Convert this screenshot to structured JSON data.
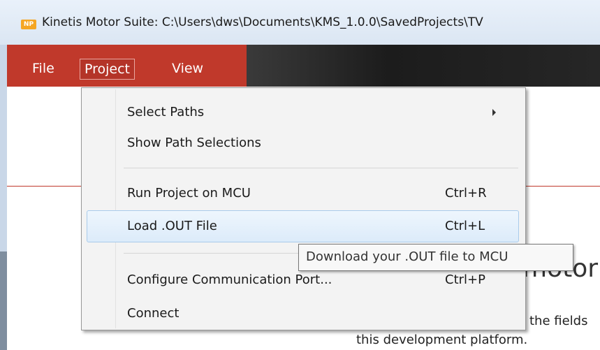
{
  "window": {
    "logo_text": "NP",
    "title": "Kinetis Motor Suite: C:\\Users\\dws\\Documents\\KMS_1.0.0\\SavedProjects\\TV"
  },
  "menubar": {
    "file": "File",
    "project": "Project",
    "view": "View"
  },
  "project_menu": {
    "items": [
      {
        "label": "Select Paths",
        "shortcut": "",
        "submenu": true
      },
      {
        "label": "Show Path Selections",
        "shortcut": ""
      },
      {
        "label": "Run Project on MCU",
        "shortcut": "Ctrl+R"
      },
      {
        "label": "Load .OUT File",
        "shortcut": "Ctrl+L",
        "highlighted": true
      },
      {
        "label": "Configure Communication Port...",
        "shortcut": "Ctrl+P"
      },
      {
        "label": "Connect",
        "shortcut": ""
      }
    ]
  },
  "tooltip": {
    "text": "Download your .OUT file to MCU"
  },
  "background": {
    "heading": "motor",
    "line1": "the fields",
    "line2": "this development platform."
  },
  "colors": {
    "menubar_red": "#c0392b",
    "menubar_dark": "#262626",
    "highlight_border": "#a9cbeb"
  }
}
